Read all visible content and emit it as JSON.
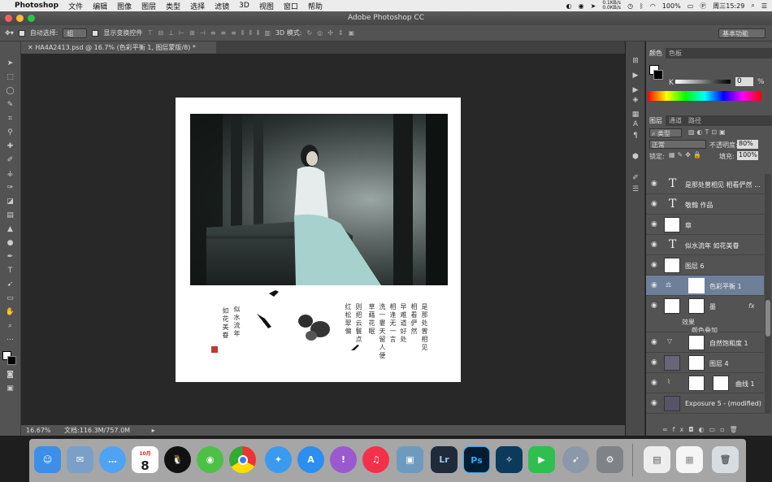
{
  "menubar": {
    "app_name": "Photoshop",
    "items": [
      "文件",
      "编辑",
      "图像",
      "图层",
      "类型",
      "选择",
      "滤镜",
      "3D",
      "视图",
      "窗口",
      "帮助"
    ],
    "net_up": "0.1KB/s",
    "net_down": "0.0KB/s",
    "battery": "100%",
    "datetime": "周三15:29"
  },
  "window": {
    "title": "Adobe Photoshop CC"
  },
  "options": {
    "auto_select_label": "自动选择:",
    "auto_select_value": "组",
    "show_transform_label": "显示变换控件",
    "mode_3d_label": "3D 模式:",
    "workspace_value": "基本功能"
  },
  "document": {
    "tab_title": "HA4A2413.psd @ 16.7% (色彩平衡 1, 图层蒙版/8) *",
    "zoom": "16.67%",
    "doc_size": "文档:116.3M/757.0M"
  },
  "artwork": {
    "poem_col1": "似水流年",
    "poem_col2": "如花美眷",
    "verses": [
      "是那处曾相见",
      "相看俨然",
      "早难道好处",
      "相逢无一言",
      "洗一霎天留人便",
      "草藉花眠",
      "则把云鬟点",
      "红松翠偏"
    ]
  },
  "color_panel": {
    "tabs": [
      "颜色",
      "色板"
    ],
    "k_label": "K",
    "k_value": "0",
    "k_unit": "%"
  },
  "layers_panel": {
    "tabs": [
      "图层",
      "通道",
      "路径"
    ],
    "filter_kind": "类型",
    "blend_mode": "正常",
    "opacity_label": "不透明度:",
    "opacity_value": "80%",
    "lock_label": "锁定:",
    "fill_label": "填充:",
    "fill_value": "100%",
    "layers": [
      {
        "name": "是那处曾相见  相看俨然 ...",
        "type": "text"
      },
      {
        "name": "敬翰 作品",
        "type": "text"
      },
      {
        "name": "章",
        "type": "pixel"
      },
      {
        "name": "似水流年  如花美眷",
        "type": "text"
      },
      {
        "name": "图层 6",
        "type": "pixel"
      },
      {
        "name": "色彩平衡 1",
        "type": "adjustment",
        "selected": true
      },
      {
        "name": "墨",
        "type": "pixel"
      },
      {
        "name": "自然饱和度 1",
        "type": "adjustment"
      },
      {
        "name": "图层 4",
        "type": "pixel"
      },
      {
        "name": "曲线 1",
        "type": "adjustment"
      },
      {
        "name": "Exposure 5 - (modified)",
        "type": "pixel"
      }
    ],
    "effects_label": "效果",
    "effect_name": "颜色叠加"
  },
  "dock": {
    "calendar_month": "10月",
    "calendar_day": "8",
    "lr_label": "Lr",
    "ps_label": "Ps"
  },
  "colors": {
    "panel_bg": "#535353",
    "canvas_bg": "#282828",
    "selected_layer": "#6e7f99",
    "stamp_red": "#c0392b"
  }
}
